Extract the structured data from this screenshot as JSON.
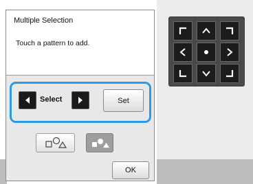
{
  "dialog": {
    "title": "Multiple Selection",
    "message": "Touch a pattern to add."
  },
  "select_group": {
    "label": "Select",
    "set_label": "Set",
    "highlight_color": "#2a9ae6"
  },
  "add_buttons": [
    {
      "name": "add-pattern-button",
      "icon": "shapes-outline-icon"
    },
    {
      "name": "add-pattern-active-button",
      "icon": "shapes-filled-icon"
    }
  ],
  "ok_label": "OK",
  "arrow_pad": {
    "buttons": [
      "up-left",
      "up",
      "up-right",
      "left",
      "center",
      "right",
      "down-left",
      "down",
      "down-right"
    ]
  },
  "colors": {
    "panel_bg": "#e8e8e8",
    "pad_bg": "#4a4a4a",
    "pad_button": "#1c1c1c"
  }
}
